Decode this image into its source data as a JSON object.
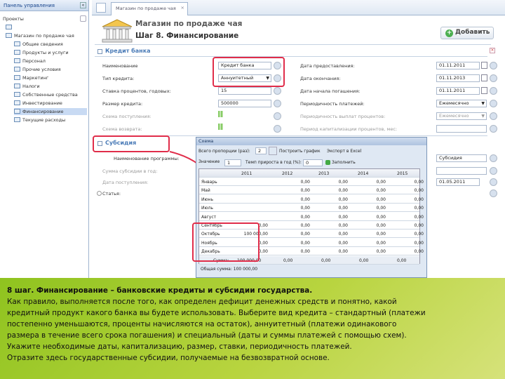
{
  "left_panel": {
    "title": "Панель управления",
    "section": "Проекты",
    "items": [
      "Магазин по продаже чая",
      "Общие сведения",
      "Продукты и услуги",
      "Персонал",
      "Прочие условия",
      "Маркетинг",
      "Налоги",
      "Собственные средства",
      "Инвестирование",
      "Финансирование",
      "Текущие расходы"
    ]
  },
  "tab": {
    "label": "Магазин по продаже чая"
  },
  "header": {
    "title": "Магазин по продаже чая",
    "subtitle": "Шаг 8. Финансирование",
    "add_label": "Добавить"
  },
  "credit": {
    "title": "Кредит банка",
    "left": [
      {
        "label": "Наименование",
        "value": "Кредит банка"
      },
      {
        "label": "Тип кредита:",
        "value": "Аннуитетный"
      },
      {
        "label": "Ставка процентов, годовых:",
        "value": "15"
      },
      {
        "label": "Размер кредита:",
        "value": "500000"
      },
      {
        "label": "Схема поступления:",
        "value": ""
      },
      {
        "label": "Схема возврата:",
        "value": ""
      }
    ],
    "right": [
      {
        "label": "Дата предоставления:",
        "value": "01.11.2011"
      },
      {
        "label": "Дата окончания:",
        "value": "01.11.2013"
      },
      {
        "label": "Дата начала погашения:",
        "value": "01.11.2011"
      },
      {
        "label": "Периодичность платежей:",
        "value": "Ежемесячно"
      },
      {
        "label": "Периодичность выплат процентов:",
        "value": "Ежемесячно"
      },
      {
        "label": "Период капитализации процентов, мес:",
        "value": ""
      }
    ]
  },
  "subsidy": {
    "title": "Субсидия",
    "left": [
      {
        "label": "Наименование программы:"
      },
      {
        "label": "Сумма субсидии в год:"
      },
      {
        "label": "Дата поступления:"
      },
      {
        "label": "Статья:"
      }
    ],
    "right": [
      {
        "value": "Субсидия"
      },
      {
        "value": "01.05.2011"
      },
      {
        "value": ""
      }
    ]
  },
  "dialog": {
    "title": "Схема",
    "period_label": "Всего пропорции (раз):",
    "period_value": "2",
    "btn_graph": "Построить график",
    "btn_excel": "Экспорт в Excel",
    "value_label": "Значение",
    "value_value": "1",
    "growth_label": "Темп прироста в год (%):",
    "growth_value": "0",
    "fill_label": "Заполнить",
    "years": [
      "2011",
      "2012",
      "2013",
      "2014",
      "2015"
    ],
    "rows": [
      {
        "m": "Январь",
        "v": [
          "",
          "0,00",
          "0,00",
          "0,00",
          "0,00"
        ]
      },
      {
        "m": "Май",
        "v": [
          "",
          "0,00",
          "0,00",
          "0,00",
          "0,00"
        ]
      },
      {
        "m": "Июнь",
        "v": [
          "",
          "0,00",
          "0,00",
          "0,00",
          "0,00"
        ]
      },
      {
        "m": "Июль",
        "v": [
          "",
          "0,00",
          "0,00",
          "0,00",
          "0,00"
        ]
      },
      {
        "m": "Август",
        "v": [
          "",
          "0,00",
          "0,00",
          "0,00",
          "0,00"
        ]
      },
      {
        "m": "Сентябрь",
        "v": [
          "0,00",
          "0,00",
          "0,00",
          "0,00",
          "0,00"
        ]
      },
      {
        "m": "Октябрь",
        "v": [
          "100 000,00",
          "0,00",
          "0,00",
          "0,00",
          "0,00"
        ]
      },
      {
        "m": "Ноябрь",
        "v": [
          "0,00",
          "0,00",
          "0,00",
          "0,00",
          "0,00"
        ]
      },
      {
        "m": "Декабрь",
        "v": [
          "0,00",
          "0,00",
          "0,00",
          "0,00",
          "0,00"
        ]
      }
    ],
    "sum_label": "Сумма:",
    "sum_value": "100 000,00",
    "total": "Общая сумма: 100 000,00"
  },
  "bottom": {
    "heading": "8 шаг. Финансирование – банковские кредиты и субсидии государства.",
    "lines": [
      "Как правило, выполняется после того, как определен дефицит денежных средств и понятно, какой",
      "кредитный продукт какого банка вы будете использовать. Выберите вид кредита – стандартный (платежи",
      "постепенно уменьшаются, проценты начисляются на остаток), аннуитетный (платежи одинакового",
      "размера в течение всего срока погашения) и специальный (даты и суммы платежей с помощью схем).",
      "Укажите необходимые даты, капитализацию, размер, ставки, периодичность платежей.",
      "Отразите здесь государственные субсидии, получаемые на безвозвратной основе."
    ]
  }
}
